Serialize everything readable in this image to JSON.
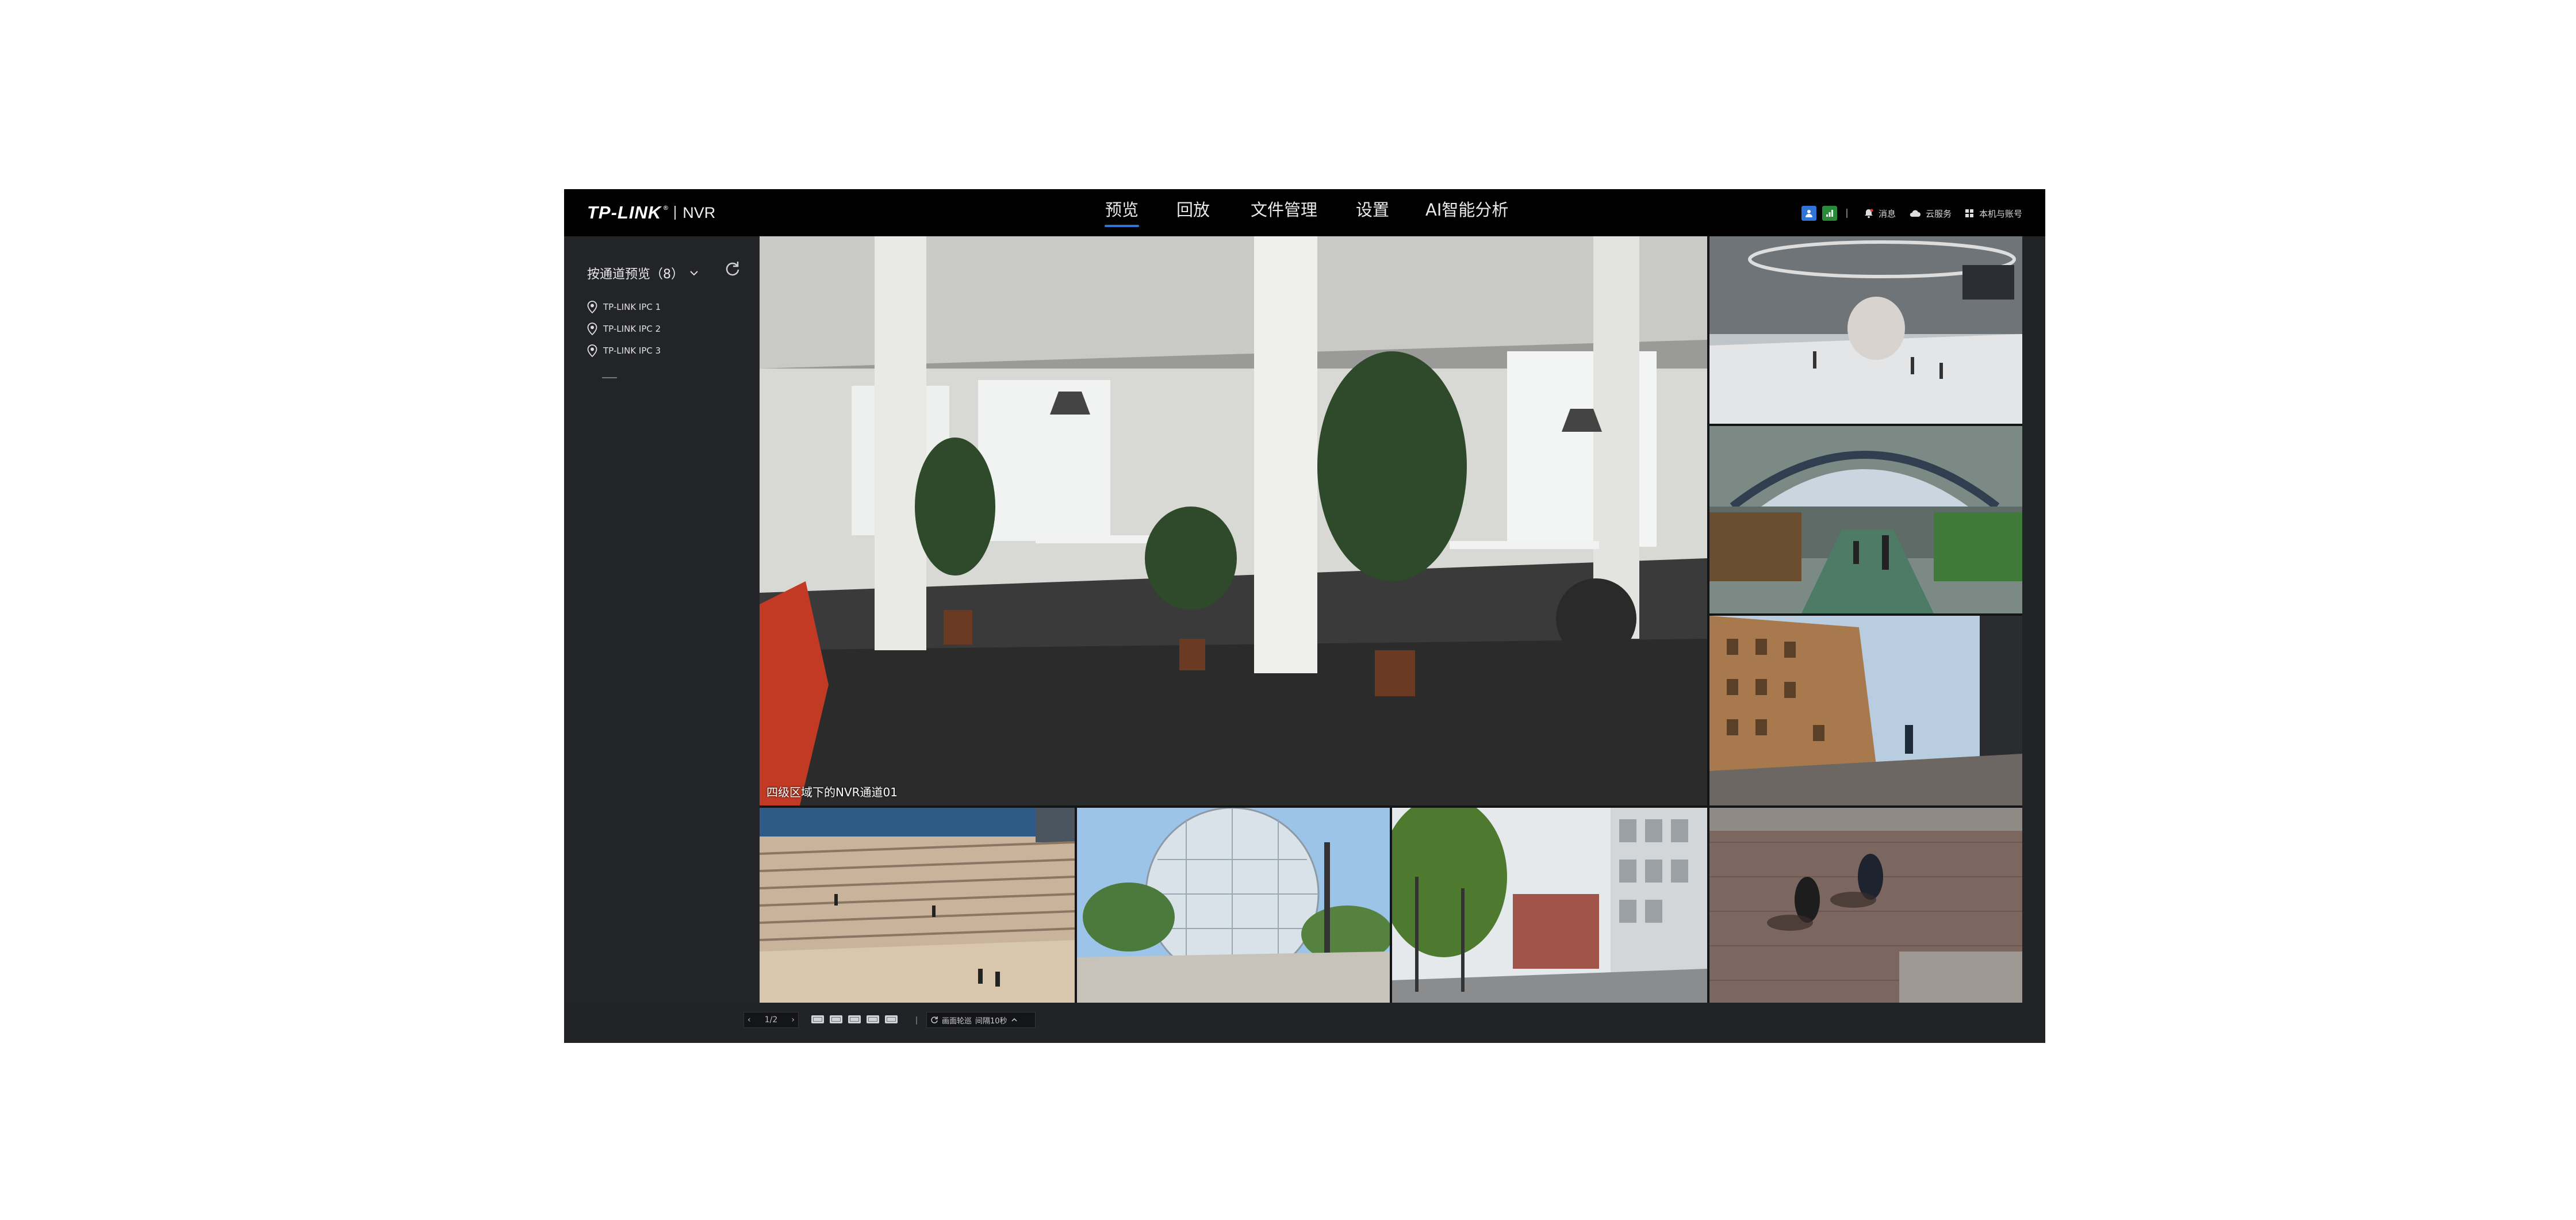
{
  "header": {
    "brand": "TP-LINK",
    "registered": "®",
    "product": "NVR",
    "nav": [
      {
        "label": "预览",
        "active": true
      },
      {
        "label": "回放",
        "active": false
      },
      {
        "label": "文件管理",
        "active": false
      },
      {
        "label": "设置",
        "active": false
      },
      {
        "label": "AI智能分析",
        "active": false
      }
    ],
    "tools": {
      "messages": "消息",
      "cloud": "云服务",
      "account": "本机与账号"
    },
    "accent_color": "#2f74d6"
  },
  "sidebar": {
    "title": "按通道预览（8）",
    "devices": [
      {
        "label": "TP-LINK IPC 1"
      },
      {
        "label": "TP-LINK IPC 2"
      },
      {
        "label": "TP-LINK IPC 3"
      }
    ]
  },
  "preview": {
    "main_channel_label": "四级区域下的NVR通道01",
    "tiles": [
      {
        "scene": "office"
      },
      {
        "scene": "mall"
      },
      {
        "scene": "market"
      },
      {
        "scene": "building"
      },
      {
        "scene": "steps"
      },
      {
        "scene": "dome"
      },
      {
        "scene": "street"
      },
      {
        "scene": "pavement"
      }
    ]
  },
  "bottombar": {
    "page": "1/2",
    "prev": "‹",
    "next": "›",
    "cycle_label": "画面轮巡",
    "interval_label": "间隔10秒"
  }
}
